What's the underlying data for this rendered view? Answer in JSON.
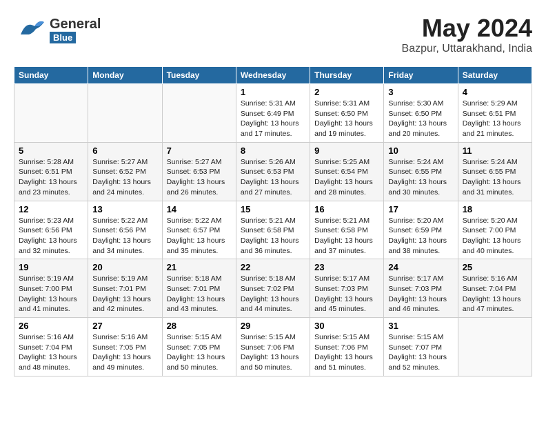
{
  "header": {
    "logo_general": "General",
    "logo_blue": "Blue",
    "title": "May 2024",
    "subtitle": "Bazpur, Uttarakhand, India"
  },
  "columns": [
    "Sunday",
    "Monday",
    "Tuesday",
    "Wednesday",
    "Thursday",
    "Friday",
    "Saturday"
  ],
  "weeks": [
    [
      {
        "day": "",
        "info": ""
      },
      {
        "day": "",
        "info": ""
      },
      {
        "day": "",
        "info": ""
      },
      {
        "day": "1",
        "info": "Sunrise: 5:31 AM\nSunset: 6:49 PM\nDaylight: 13 hours\nand 17 minutes."
      },
      {
        "day": "2",
        "info": "Sunrise: 5:31 AM\nSunset: 6:50 PM\nDaylight: 13 hours\nand 19 minutes."
      },
      {
        "day": "3",
        "info": "Sunrise: 5:30 AM\nSunset: 6:50 PM\nDaylight: 13 hours\nand 20 minutes."
      },
      {
        "day": "4",
        "info": "Sunrise: 5:29 AM\nSunset: 6:51 PM\nDaylight: 13 hours\nand 21 minutes."
      }
    ],
    [
      {
        "day": "5",
        "info": "Sunrise: 5:28 AM\nSunset: 6:51 PM\nDaylight: 13 hours\nand 23 minutes."
      },
      {
        "day": "6",
        "info": "Sunrise: 5:27 AM\nSunset: 6:52 PM\nDaylight: 13 hours\nand 24 minutes."
      },
      {
        "day": "7",
        "info": "Sunrise: 5:27 AM\nSunset: 6:53 PM\nDaylight: 13 hours\nand 26 minutes."
      },
      {
        "day": "8",
        "info": "Sunrise: 5:26 AM\nSunset: 6:53 PM\nDaylight: 13 hours\nand 27 minutes."
      },
      {
        "day": "9",
        "info": "Sunrise: 5:25 AM\nSunset: 6:54 PM\nDaylight: 13 hours\nand 28 minutes."
      },
      {
        "day": "10",
        "info": "Sunrise: 5:24 AM\nSunset: 6:55 PM\nDaylight: 13 hours\nand 30 minutes."
      },
      {
        "day": "11",
        "info": "Sunrise: 5:24 AM\nSunset: 6:55 PM\nDaylight: 13 hours\nand 31 minutes."
      }
    ],
    [
      {
        "day": "12",
        "info": "Sunrise: 5:23 AM\nSunset: 6:56 PM\nDaylight: 13 hours\nand 32 minutes."
      },
      {
        "day": "13",
        "info": "Sunrise: 5:22 AM\nSunset: 6:56 PM\nDaylight: 13 hours\nand 34 minutes."
      },
      {
        "day": "14",
        "info": "Sunrise: 5:22 AM\nSunset: 6:57 PM\nDaylight: 13 hours\nand 35 minutes."
      },
      {
        "day": "15",
        "info": "Sunrise: 5:21 AM\nSunset: 6:58 PM\nDaylight: 13 hours\nand 36 minutes."
      },
      {
        "day": "16",
        "info": "Sunrise: 5:21 AM\nSunset: 6:58 PM\nDaylight: 13 hours\nand 37 minutes."
      },
      {
        "day": "17",
        "info": "Sunrise: 5:20 AM\nSunset: 6:59 PM\nDaylight: 13 hours\nand 38 minutes."
      },
      {
        "day": "18",
        "info": "Sunrise: 5:20 AM\nSunset: 7:00 PM\nDaylight: 13 hours\nand 40 minutes."
      }
    ],
    [
      {
        "day": "19",
        "info": "Sunrise: 5:19 AM\nSunset: 7:00 PM\nDaylight: 13 hours\nand 41 minutes."
      },
      {
        "day": "20",
        "info": "Sunrise: 5:19 AM\nSunset: 7:01 PM\nDaylight: 13 hours\nand 42 minutes."
      },
      {
        "day": "21",
        "info": "Sunrise: 5:18 AM\nSunset: 7:01 PM\nDaylight: 13 hours\nand 43 minutes."
      },
      {
        "day": "22",
        "info": "Sunrise: 5:18 AM\nSunset: 7:02 PM\nDaylight: 13 hours\nand 44 minutes."
      },
      {
        "day": "23",
        "info": "Sunrise: 5:17 AM\nSunset: 7:03 PM\nDaylight: 13 hours\nand 45 minutes."
      },
      {
        "day": "24",
        "info": "Sunrise: 5:17 AM\nSunset: 7:03 PM\nDaylight: 13 hours\nand 46 minutes."
      },
      {
        "day": "25",
        "info": "Sunrise: 5:16 AM\nSunset: 7:04 PM\nDaylight: 13 hours\nand 47 minutes."
      }
    ],
    [
      {
        "day": "26",
        "info": "Sunrise: 5:16 AM\nSunset: 7:04 PM\nDaylight: 13 hours\nand 48 minutes."
      },
      {
        "day": "27",
        "info": "Sunrise: 5:16 AM\nSunset: 7:05 PM\nDaylight: 13 hours\nand 49 minutes."
      },
      {
        "day": "28",
        "info": "Sunrise: 5:15 AM\nSunset: 7:05 PM\nDaylight: 13 hours\nand 50 minutes."
      },
      {
        "day": "29",
        "info": "Sunrise: 5:15 AM\nSunset: 7:06 PM\nDaylight: 13 hours\nand 50 minutes."
      },
      {
        "day": "30",
        "info": "Sunrise: 5:15 AM\nSunset: 7:06 PM\nDaylight: 13 hours\nand 51 minutes."
      },
      {
        "day": "31",
        "info": "Sunrise: 5:15 AM\nSunset: 7:07 PM\nDaylight: 13 hours\nand 52 minutes."
      },
      {
        "day": "",
        "info": ""
      }
    ]
  ]
}
